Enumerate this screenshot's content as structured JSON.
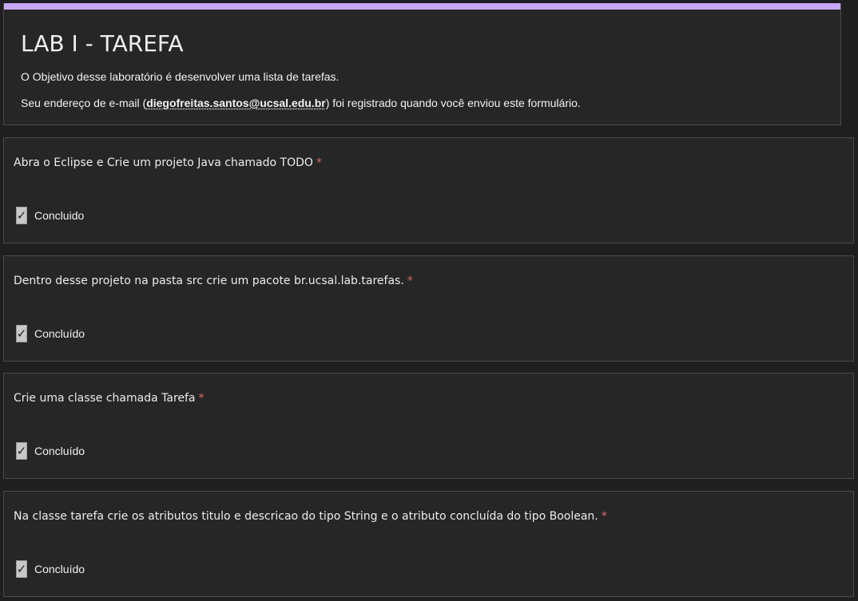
{
  "header": {
    "title": "LAB I - TAREFA",
    "description": "O Objetivo desse laboratório é desenvolver uma lista de tarefas.",
    "email_prefix": "Seu endereço de e-mail (",
    "email": "diegofreitas.santos@ucsal.edu.br",
    "email_suffix": ") foi registrado quando você enviou este formulário.",
    "accent_color": "#c9a7f2"
  },
  "questions": [
    {
      "text": "Abra o Eclipse e Crie um projeto Java chamado TODO",
      "required_mark": "*",
      "option_label": "Concluido",
      "checked": true,
      "check_icon": "✓"
    },
    {
      "text": "Dentro desse projeto na pasta src crie um pacote br.ucsal.lab.tarefas.",
      "required_mark": "*",
      "option_label": "Concluído",
      "checked": true,
      "check_icon": "✓"
    },
    {
      "text": "Crie uma classe chamada Tarefa",
      "required_mark": "*",
      "option_label": "Concluído",
      "checked": true,
      "check_icon": "✓"
    },
    {
      "text": "Na classe tarefa crie os atributos titulo e descricao do tipo String e o atributo concluída do tipo Boolean.",
      "required_mark": "*",
      "option_label": "Concluído",
      "checked": true,
      "check_icon": "✓"
    }
  ]
}
